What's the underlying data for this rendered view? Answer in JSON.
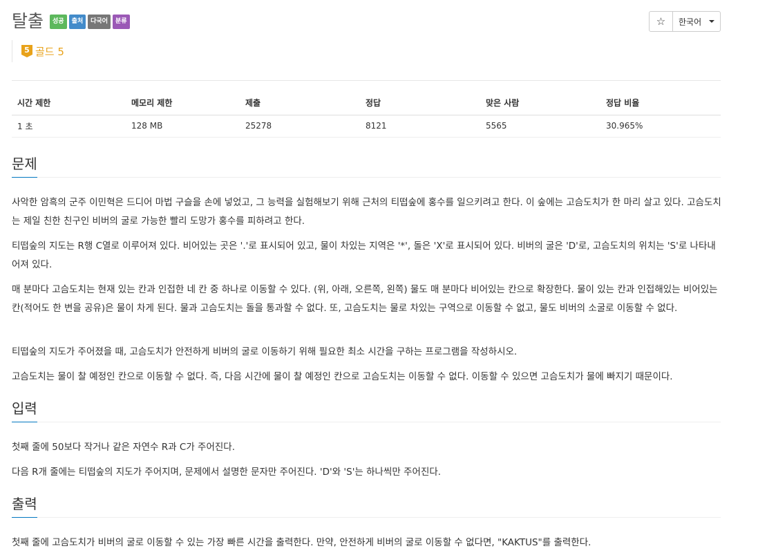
{
  "problem": {
    "title": "탈출",
    "badges": [
      {
        "label": "성공",
        "color": "#5cb85c"
      },
      {
        "label": "출처",
        "color": "#428bca"
      },
      {
        "label": "다국어",
        "color": "#777777"
      },
      {
        "label": "분류",
        "color": "#9b59b6"
      }
    ],
    "tier_level": "5",
    "tier_label": "골드 5"
  },
  "toolbar": {
    "star": "☆",
    "language": "한국어"
  },
  "info": {
    "headers": [
      "시간 제한",
      "메모리 제한",
      "제출",
      "정답",
      "맞은 사람",
      "정답 비율"
    ],
    "values": [
      "1 초",
      "128 MB",
      "25278",
      "8121",
      "5565",
      "30.965%"
    ]
  },
  "sections": {
    "description": {
      "heading": "문제",
      "paragraphs": [
        "사악한 암흑의 군주 이민혁은 드디어 마법 구슬을 손에 넣었고, 그 능력을 실험해보기 위해 근처의 티떱숲에 홍수를 일으키려고 한다. 이 숲에는 고슴도치가 한 마리 살고 있다. 고슴도치는 제일 친한 친구인 비버의 굴로 가능한 빨리 도망가 홍수를 피하려고 한다.",
        "티떱숲의 지도는 R행 C열로 이루어져 있다. 비어있는 곳은 '.'로 표시되어 있고, 물이 차있는 지역은 '*', 돌은 'X'로 표시되어 있다. 비버의 굴은 'D'로, 고슴도치의 위치는 'S'로 나타내어져 있다.",
        "매 분마다 고슴도치는 현재 있는 칸과 인접한 네 칸 중 하나로 이동할 수 있다. (위, 아래, 오른쪽, 왼쪽) 물도 매 분마다 비어있는 칸으로 확장한다. 물이 있는 칸과 인접해있는 비어있는 칸(적어도 한 변을 공유)은 물이 차게 된다. 물과 고슴도치는 돌을 통과할 수 없다. 또, 고슴도치는 물로 차있는 구역으로 이동할 수 없고, 물도 비버의 소굴로 이동할 수 없다.",
        "티떱숲의 지도가 주어졌을 때, 고슴도치가 안전하게 비버의 굴로 이동하기 위해 필요한 최소 시간을 구하는 프로그램을 작성하시오.",
        "고슴도치는 물이 찰 예정인 칸으로 이동할 수 없다. 즉, 다음 시간에 물이 찰 예정인 칸으로 고슴도치는 이동할 수 없다. 이동할 수 있으면 고슴도치가 물에 빠지기 때문이다."
      ]
    },
    "input": {
      "heading": "입력",
      "paragraphs": [
        "첫째 줄에 50보다 작거나 같은 자연수 R과 C가 주어진다.",
        "다음 R개 줄에는 티떱숲의 지도가 주어지며, 문제에서 설명한 문자만 주어진다. 'D'와 'S'는 하나씩만 주어진다."
      ]
    },
    "output": {
      "heading": "출력",
      "paragraphs": [
        "첫째 줄에 고슴도치가 비버의 굴로 이동할 수 있는 가장 빠른 시간을 출력한다. 만약, 안전하게 비버의 굴로 이동할 수 없다면, \"KAKTUS\"를 출력한다."
      ]
    }
  }
}
